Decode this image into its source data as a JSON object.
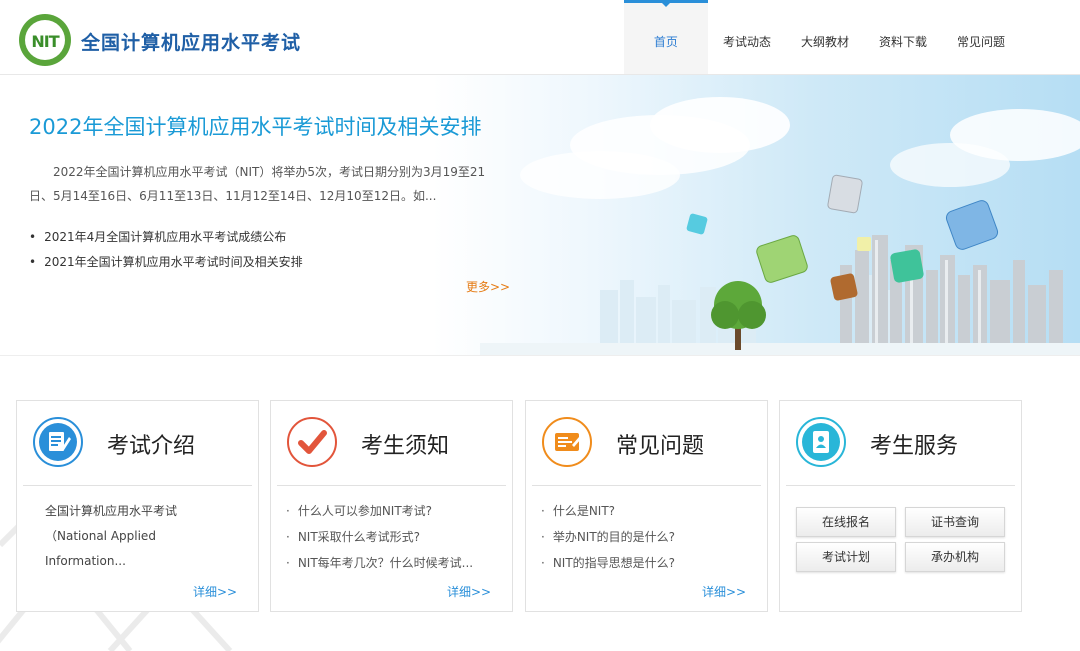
{
  "header": {
    "logo_text": "NIT",
    "site_title": "全国计算机应用水平考试",
    "nav": [
      "首页",
      "考试动态",
      "大纲教材",
      "资料下载",
      "常见问题"
    ]
  },
  "banner": {
    "title": "2022年全国计算机应用水平考试时间及相关安排",
    "description": "2022年全国计算机应用水平考试（NIT）将举办5次，考试日期分别为3月19至21日、5月14至16日、6月11至13日、11月12至14日、12月10至12日。如...",
    "links": [
      "2021年4月全国计算机应用水平考试成绩公布",
      "2021年全国计算机应用水平考试时间及相关安排"
    ],
    "more": "更多>>"
  },
  "cards": {
    "intro": {
      "title": "考试介绍",
      "para": "全国计算机应用水平考试（National Applied Information...",
      "detail": "详细>>"
    },
    "notice": {
      "title": "考生须知",
      "items": [
        "什么人可以参加NIT考试?",
        "NIT采取什么考试形式?",
        "NIT每年考几次？什么时候考试..."
      ],
      "detail": "详细>>"
    },
    "faq": {
      "title": "常见问题",
      "items": [
        "什么是NIT?",
        "举办NIT的目的是什么?",
        "NIT的指导思想是什么?"
      ],
      "detail": "详细>>"
    },
    "service": {
      "title": "考生服务",
      "buttons": [
        "在线报名",
        "证书查询",
        "考试计划",
        "承办机构"
      ]
    }
  },
  "colors": {
    "accent": "#2a8fd9",
    "title_blue": "#1a9ad6",
    "more_orange": "#e57c15",
    "logo_green": "#5aa53b"
  }
}
